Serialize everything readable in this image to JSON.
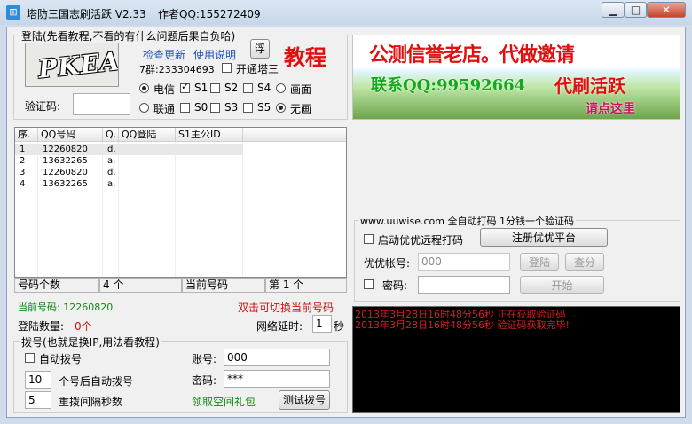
{
  "window": {
    "title": "塔防三国志刷活跃 V2.33",
    "author": "作者QQ:155272409"
  },
  "login_group": {
    "title": "登陆(先看教程,不看的有什么问题后果自负哈)",
    "captcha_text": "PKEA",
    "check_update": "检查更新",
    "usage": "使用说明",
    "float_button": "浮",
    "tutorial": "教程",
    "group_qq": "7群:233304693",
    "open_tower3": "开通塔三",
    "telecom": "电信",
    "unicom": "联通",
    "s0": "S0",
    "s1": "S1",
    "s2": "S2",
    "s3": "S3",
    "s4": "S4",
    "s5": "S5",
    "with_image": "画面",
    "no_image": "无画",
    "captcha_label": "验证码:"
  },
  "banner": {
    "line1": "公测信誉老店。代做邀请",
    "contact": "联系QQ:99592664",
    "service": "代刷活跃",
    "click": "请点这里"
  },
  "table": {
    "headers": [
      "序.",
      "QQ号码",
      "Q.",
      "QQ登陆",
      "S1主公ID"
    ],
    "rows": [
      [
        "1",
        "12260820",
        "d."
      ],
      [
        "2",
        "13632265",
        "a."
      ],
      [
        "3",
        "12260820",
        "d."
      ],
      [
        "4",
        "13632265",
        "a."
      ]
    ]
  },
  "status_bar": {
    "count_label": "号码个数",
    "count_value": "4 个",
    "current_label": "当前号码",
    "current_value": "第 1 个"
  },
  "current": {
    "label": "当前号码: 12260820",
    "switch_hint": "双击可切换当前号码",
    "login_count_label": "登陆数量:",
    "login_count_value": "0个",
    "network_delay_label": "网络延时:",
    "network_delay_value": "1",
    "network_delay_unit": "秒"
  },
  "dial_group": {
    "title": "拨号(也就是换IP,用法看教程)",
    "auto_dial": "自动拨号",
    "count_value": "10",
    "count_suffix": "个号后自动拨号",
    "interval_value": "5",
    "interval_suffix": "重拨间隔秒数",
    "account_label": "账号:",
    "account_value": "000",
    "password_label": "密码:",
    "password_value": "***",
    "gift_link": "领取空间礼包",
    "test_button": "测试拨号"
  },
  "captcha_group": {
    "title": "www.uuwise.com 全自动打码 1分钱一个验证码",
    "enable_remote": "启动优优远程打码",
    "register_button": "注册优优平台",
    "account_label": "优优帐号:",
    "account_value": "000",
    "login_button": "登陆",
    "query_button": "查分",
    "password_label": "密码:",
    "start_button": "开始"
  },
  "log": {
    "lines": [
      "2013年3月28日16时48分56秒 正在获取验证码",
      "2013年3月28日16时48分56秒 验证码获取完毕!"
    ]
  }
}
